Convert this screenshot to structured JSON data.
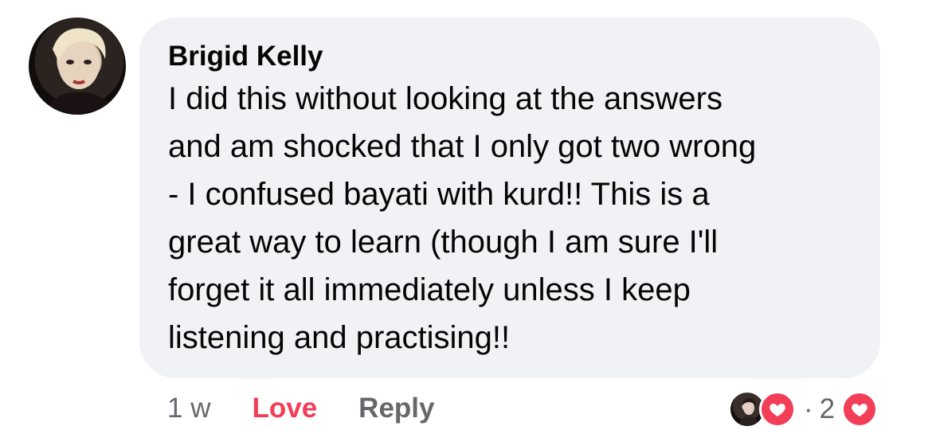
{
  "comment": {
    "author": "Brigid Kelly",
    "text": "I did this without looking at the answers\nand am shocked that I only got two wrong\n- I confused bayati with kurd!! This is a\ngreat way to learn (though I am sure I'll\nforget it all immediately unless I keep\nlistening and practising!!"
  },
  "actions": {
    "timestamp": "1 w",
    "love_label": "Love",
    "reply_label": "Reply"
  },
  "reactions": {
    "separator": "·",
    "count": "2",
    "icon": "heart-icon",
    "color": "#f33e58"
  }
}
